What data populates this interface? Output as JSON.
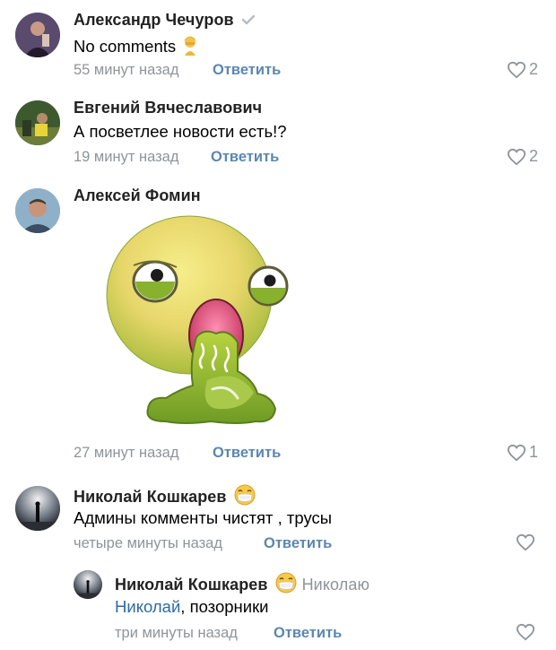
{
  "comments": [
    {
      "author": "Александр Чечуров",
      "text": "No comments",
      "time": "55 минут назад",
      "reply_label": "Ответить",
      "likes": "2",
      "verified": true
    },
    {
      "author": "Евгений Вячеславович",
      "text": "А посветлее новости есть!?",
      "time": "19 минут назад",
      "reply_label": "Ответить",
      "likes": "2"
    },
    {
      "author": "Алексей Фомин",
      "time": "27 минут назад",
      "reply_label": "Ответить",
      "likes": "1",
      "sticker": "vomiting-face-sticker"
    },
    {
      "author": "Николай Кошкарев",
      "text": "Админы комменты чистят , трусы",
      "time": "четыре минуты назад",
      "reply_label": "Ответить",
      "likes": ""
    },
    {
      "author": "Николай Кошкарев",
      "addressee": "Николаю",
      "mention": "Николай",
      "text_rest": ", позорники",
      "time": "три минуты назад",
      "reply_label": "Ответить",
      "likes": ""
    }
  ],
  "colors": {
    "link": "#5b87b1",
    "meta": "#8e949a",
    "mention": "#2e6aa6"
  }
}
